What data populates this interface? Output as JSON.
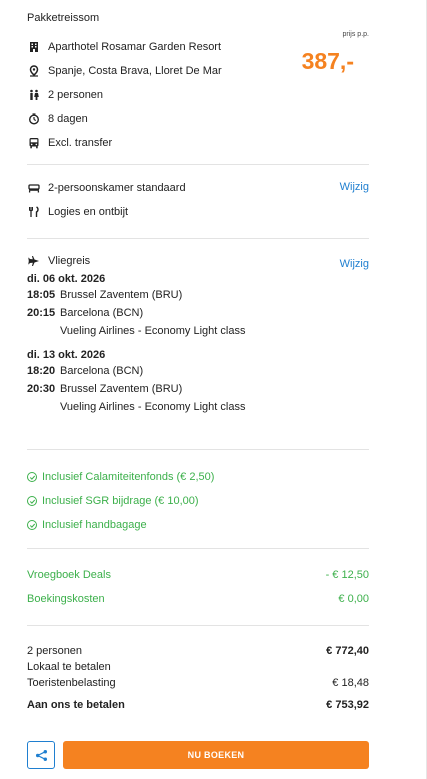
{
  "package": {
    "heading": "Pakketreissom",
    "price_label": "prijs p.p.",
    "price": "387,-",
    "items": [
      {
        "icon": "building-icon",
        "text": "Aparthotel Rosamar Garden Resort"
      },
      {
        "icon": "location-pin-icon",
        "text": "Spanje, Costa Brava, Lloret De Mar"
      },
      {
        "icon": "people-icon",
        "text": "2 personen"
      },
      {
        "icon": "clock-icon",
        "text": "8 dagen"
      },
      {
        "icon": "bus-icon",
        "text": "Excl. transfer"
      }
    ]
  },
  "room": {
    "room_type": "2-persoonskamer standaard",
    "board": "Logies en ontbijt",
    "edit_label": "Wijzig"
  },
  "flight": {
    "label": "Vliegreis",
    "edit_label": "Wijzig",
    "outbound": {
      "date": "di. 06 okt. 2026",
      "dep_time": "18:05",
      "dep_place": "Brussel Zaventem (BRU)",
      "arr_time": "20:15",
      "arr_place": "Barcelona (BCN)",
      "airline": "Vueling Airlines - Economy Light class"
    },
    "return": {
      "date": "di. 13 okt. 2026",
      "dep_time": "18:20",
      "dep_place": "Barcelona (BCN)",
      "arr_time": "20:30",
      "arr_place": "Brussel Zaventem (BRU)",
      "airline": "Vueling Airlines - Economy Light class"
    }
  },
  "inclusions": [
    "Inclusief Calamiteitenfonds (€ 2,50)",
    "Inclusief SGR bijdrage (€ 10,00)",
    "Inclusief handbagage"
  ],
  "discounts": [
    {
      "label": "Vroegboek Deals",
      "value": "- € 12,50"
    },
    {
      "label": "Boekingskosten",
      "value": "€ 0,00"
    }
  ],
  "summary": {
    "persons_label": "2 personen",
    "persons_value": "€ 772,40",
    "local_label": "Lokaal te betalen",
    "tax_label": "Toeristenbelasting",
    "tax_value": "€ 18,48",
    "total_label": "Aan ons te betalen",
    "total_value": "€ 753,92"
  },
  "actions": {
    "book_label": "NU BOEKEN",
    "share_icon": "share-icon"
  },
  "colors": {
    "accent_orange": "#f58220",
    "link_blue": "#1f7fd0",
    "success_green": "#3cb04b"
  }
}
